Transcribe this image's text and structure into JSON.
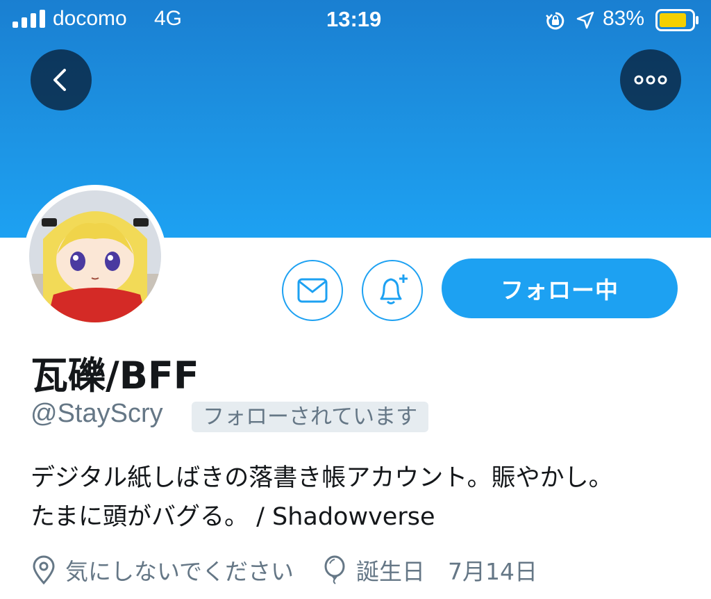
{
  "status_bar": {
    "carrier": "docomo",
    "network": "4G",
    "time": "13:19",
    "battery_percent": "83%",
    "icons": [
      "signal-icon",
      "rotation-lock-icon",
      "location-arrow-icon",
      "battery-icon"
    ]
  },
  "header": {
    "back_icon": "chevron-left-icon",
    "more_icon": "more-dots-icon"
  },
  "profile": {
    "display_name": "瓦礫/BFF",
    "handle": "@StayScry",
    "follows_you_badge": "フォローされています",
    "bio_lines": [
      "デジタル紙しばきの落書き帳アカウント。賑やかし。",
      "たまに頭がバグる。 / Shadowverse"
    ],
    "location": "気にしないでください",
    "birthday": "誕生日　7月14日"
  },
  "actions": {
    "message_icon": "envelope-icon",
    "notify_icon": "bell-plus-icon",
    "follow_label": "フォロー中"
  },
  "colors": {
    "accent": "#1da1f2",
    "banner_top": "#1a7fd1",
    "text_secondary": "#657786"
  }
}
